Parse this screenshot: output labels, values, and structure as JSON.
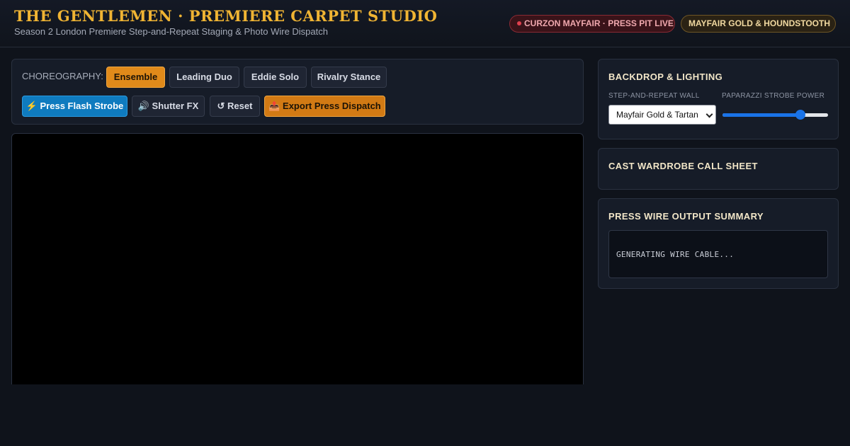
{
  "header": {
    "title": "THE GENTLEMEN · PREMIERE CARPET STUDIO",
    "subtitle": "Season 2 London Premiere Step-and-Repeat Staging & Photo Wire Dispatch",
    "live_badge": "CURZON MAYFAIR · PRESS PIT LIVE",
    "theme_badge": "MAYFAIR GOLD & HOUNDSTOOTH"
  },
  "toolbar": {
    "choreography_label": "CHOREOGRAPHY:",
    "choreography_options": [
      {
        "label": "Ensemble",
        "active": true
      },
      {
        "label": "Leading Duo",
        "active": false
      },
      {
        "label": "Eddie Solo",
        "active": false
      },
      {
        "label": "Rivalry Stance",
        "active": false
      }
    ],
    "press_flash_label": "⚡ Press Flash Strobe",
    "shutter_fx_label": "🔊 Shutter FX",
    "reset_label": "↺ Reset",
    "export_label": "📤 Export Press Dispatch"
  },
  "backdrop": {
    "title": "BACKDROP & LIGHTING",
    "wall_label": "STEP-AND-REPEAT WALL",
    "wall_selected": "Mayfair Gold & Tartan",
    "strobe_label": "PAPARAZZI STROBE POWER",
    "strobe_level": 0.74
  },
  "wardrobe": {
    "title": "CAST WARDROBE CALL SHEET"
  },
  "wire": {
    "title": "PRESS WIRE OUTPUT SUMMARY",
    "output_text": "GENERATING WIRE CABLE..."
  },
  "colors": {
    "accent_gold": "#f0b433",
    "active_orange": "#e08a1a",
    "flash_blue": "#0f7bbf",
    "live_red": "#e0404e"
  }
}
